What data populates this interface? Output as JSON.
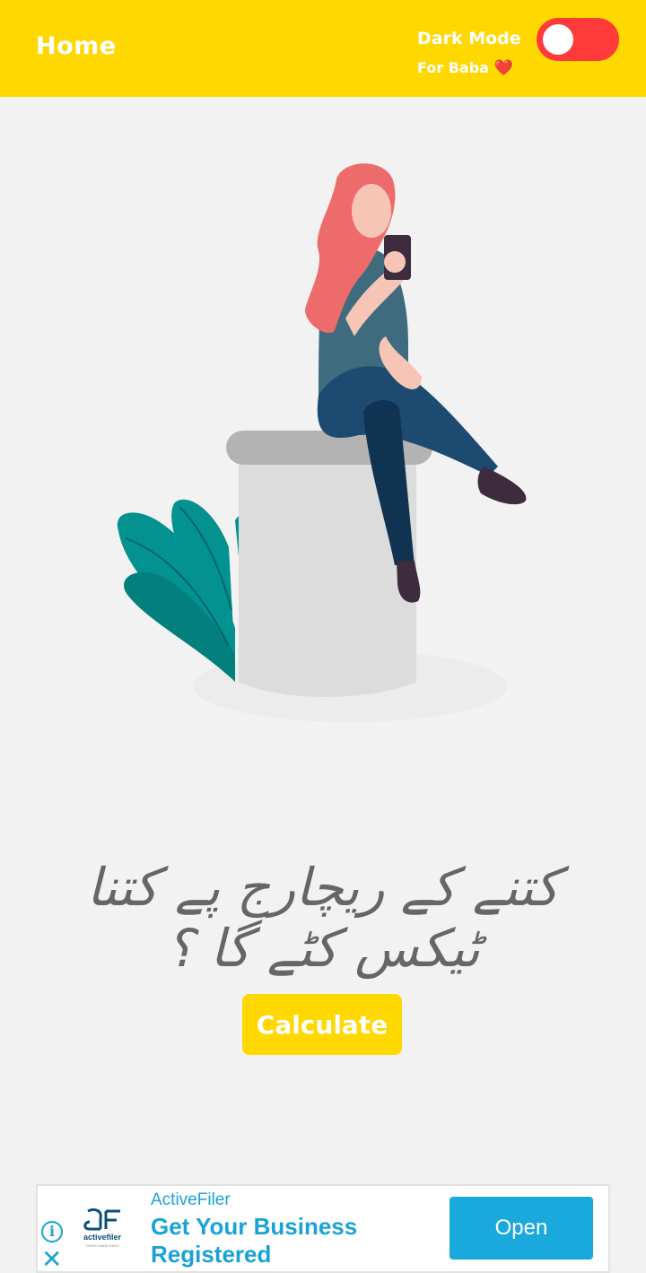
{
  "appbar": {
    "title": "Home",
    "dark_mode_label": "Dark Mode",
    "subtitle": "For Baba",
    "heart": "❤️",
    "dark_mode_on": false
  },
  "main": {
    "question": "کتنے کے ریچارج پے کتنا ٹیکس کٹے گا ؟",
    "calculate_label": "Calculate"
  },
  "ad": {
    "brand": "ActiveFiler",
    "headline": "Get Your Business Registered",
    "open_label": "Open",
    "info_icon": "i",
    "close_icon": "✕",
    "logo_text": "activefiler",
    "logo_tagline": "TAXES MADE EASY"
  },
  "colors": {
    "primary": "#ffd800",
    "toggle_track": "#ff3a3a",
    "ad_accent": "#1aa3d6"
  }
}
